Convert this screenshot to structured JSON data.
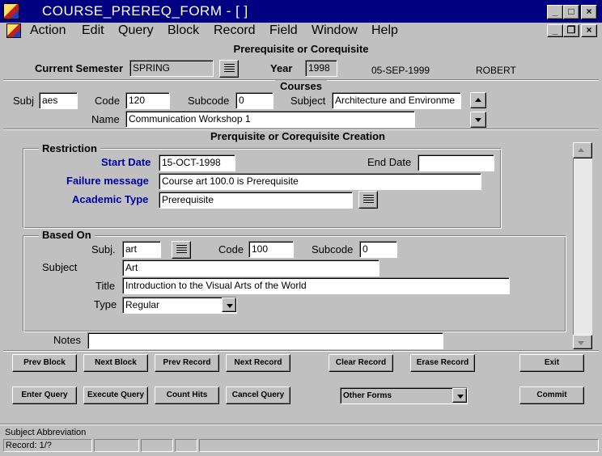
{
  "window": {
    "title": "COURSE_PREREQ_FORM - [ ]",
    "minimize_icon": "minimize-icon",
    "maximize_icon": "maximize-icon",
    "close_icon": "close-icon"
  },
  "menu": {
    "items": [
      {
        "label": "Action"
      },
      {
        "label": "Edit"
      },
      {
        "label": "Query"
      },
      {
        "label": "Block"
      },
      {
        "label": "Record"
      },
      {
        "label": "Field"
      },
      {
        "label": "Window"
      },
      {
        "label": "Help"
      }
    ]
  },
  "header": {
    "form_title": "Prerequisite or Corequisite",
    "semester_label": "Current Semester",
    "semester_value": "SPRING",
    "year_label": "Year",
    "year_value": "1998",
    "date": "05-SEP-1999",
    "user": "ROBERT"
  },
  "courses": {
    "section_title": "Courses",
    "subj_label": "Subj",
    "subj_value": "aes",
    "code_label": "Code",
    "code_value": "120",
    "subcode_label": "Subcode",
    "subcode_value": "0",
    "subject_label": "Subject",
    "subject_value": "Architecture and Environme",
    "name_label": "Name",
    "name_value": "Communication Workshop 1"
  },
  "creation": {
    "section_title": "Prerquisite or Corequisite Creation",
    "restriction": {
      "legend": "Restriction",
      "start_date_label": "Start Date",
      "start_date_value": "15-OCT-1998",
      "end_date_label": "End Date",
      "end_date_value": "",
      "failure_label": "Failure message",
      "failure_value": "Course art 100.0 is Prerequisite",
      "academic_type_label": "Academic Type",
      "academic_type_value": "Prerequisite"
    },
    "based_on": {
      "legend": "Based On",
      "subj_label": "Subj.",
      "subj_value": "art",
      "code_label": "Code",
      "code_value": "100",
      "subcode_label": "Subcode",
      "subcode_value": "0",
      "subject_label": "Subject",
      "subject_value": "Art",
      "title_label": "Title",
      "title_value": "Introduction to the Visual Arts of the World",
      "type_label": "Type",
      "type_value": "Regular"
    },
    "notes_label": "Notes",
    "notes_value": ""
  },
  "buttons": {
    "prev_block": "Prev Block",
    "next_block": "Next Block",
    "prev_record": "Prev Record",
    "next_record": "Next Record",
    "clear_record": "Clear Record",
    "erase_record": "Erase Record",
    "exit": "Exit",
    "enter_query": "Enter Query",
    "execute_query": "Execute Query",
    "count_hits": "Count Hits",
    "cancel_query": "Cancel Query",
    "other_forms": "Other Forms",
    "commit": "Commit"
  },
  "status": {
    "hint": "Subject Abbreviation",
    "record": "Record: 1/?"
  }
}
